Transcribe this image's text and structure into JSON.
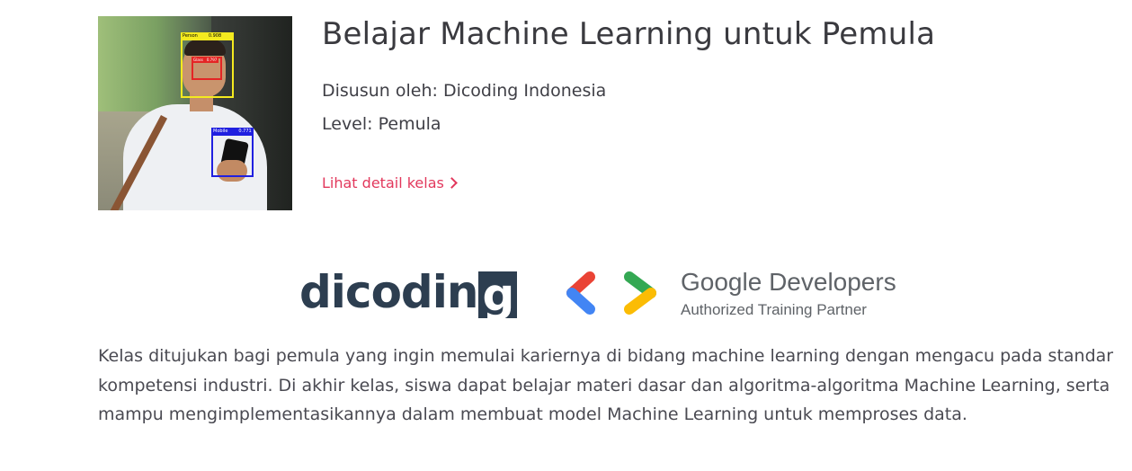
{
  "course": {
    "title": "Belajar Machine Learning untuk Pemula",
    "author": "Disusun oleh: Dicoding Indonesia",
    "level": "Level: Pemula",
    "detail_link": "Lihat detail kelas",
    "description": "Kelas ditujukan bagi pemula yang ingin memulai kariernya di bidang machine learning dengan mengacu pada standar kompetensi industri. Di akhir kelas, siswa dapat belajar materi dasar dan algoritma-algoritma Machine Learning, serta mampu mengimplementasikannya dalam membuat model Machine Learning untuk memproses data."
  },
  "thumbnail": {
    "detections": [
      {
        "label": "Person",
        "score": "0.908"
      },
      {
        "label": "Glass",
        "score": "0.797"
      },
      {
        "label": "Mobile",
        "score": "0.771"
      }
    ]
  },
  "partners": {
    "dicoding": {
      "text": "dicodin",
      "last_letter": "g"
    },
    "google": {
      "name_first": "Google",
      "name_second": " Developers",
      "subtitle": "Authorized Training Partner"
    }
  },
  "colors": {
    "link": "#e2385c",
    "dicoding": "#2d3e50",
    "google_red": "#ea4335",
    "google_blue": "#4285f4",
    "google_green": "#34a853",
    "google_yellow": "#fbbc04"
  },
  "icons": {
    "detail_link": "chevron-right-icon"
  }
}
